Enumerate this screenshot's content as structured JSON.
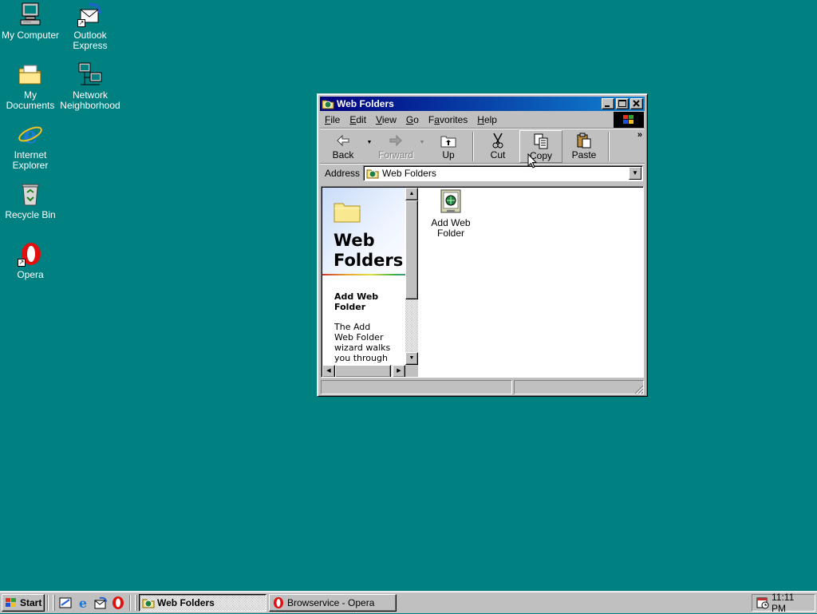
{
  "desktop": {
    "icons": [
      {
        "label": "My Computer",
        "icon": "computer-icon"
      },
      {
        "label": "Outlook Express",
        "icon": "mail-icon"
      },
      {
        "label": "My Documents",
        "icon": "folder-icon"
      },
      {
        "label": "Network Neighborhood",
        "icon": "network-icon"
      },
      {
        "label": "Internet Explorer",
        "icon": "ie-icon"
      },
      {
        "label": "Recycle Bin",
        "icon": "recycle-bin-icon"
      },
      {
        "label": "Opera",
        "icon": "opera-icon"
      }
    ],
    "background_color": "#008080"
  },
  "window": {
    "title": "Web Folders",
    "menu": [
      "File",
      "Edit",
      "View",
      "Go",
      "Favorites",
      "Help"
    ],
    "menu_access_keys": [
      "F",
      "E",
      "V",
      "G",
      "a",
      "H"
    ],
    "toolbar": {
      "back": "Back",
      "forward": "Forward",
      "up": "Up",
      "cut": "Cut",
      "copy": "Copy",
      "paste": "Paste",
      "more": "»"
    },
    "address": {
      "label": "Address",
      "value": "Web Folders"
    },
    "left_pane": {
      "title_line1": "Web",
      "title_line2": "Folders",
      "heading_line1": "Add Web",
      "heading_line2": "Folder",
      "body_lines": [
        "The Add",
        "Web Folder",
        "wizard walks",
        "you through"
      ]
    },
    "items": [
      {
        "label_line1": "Add Web",
        "label_line2": "Folder"
      }
    ]
  },
  "taskbar": {
    "start_label": "Start",
    "tasks": [
      {
        "label": "Web Folders",
        "active": true
      },
      {
        "label": "Browservice - Opera",
        "active": false
      }
    ],
    "clock": "11:11 PM"
  }
}
